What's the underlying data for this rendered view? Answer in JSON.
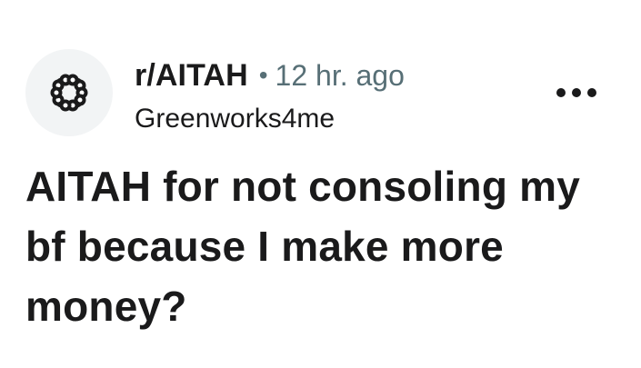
{
  "post": {
    "subreddit": "r/AITAH",
    "separator": "•",
    "time": "12 hr. ago",
    "author": "Greenworks4me",
    "title": "AITAH for not consoling my bf because I make more money?",
    "avatar_icon": "subreddit-network-icon",
    "menu_icon": "more-options-icon"
  },
  "colors": {
    "text": "#1a1a1b",
    "muted": "#576f76",
    "avatar_background": "#f2f4f5"
  }
}
